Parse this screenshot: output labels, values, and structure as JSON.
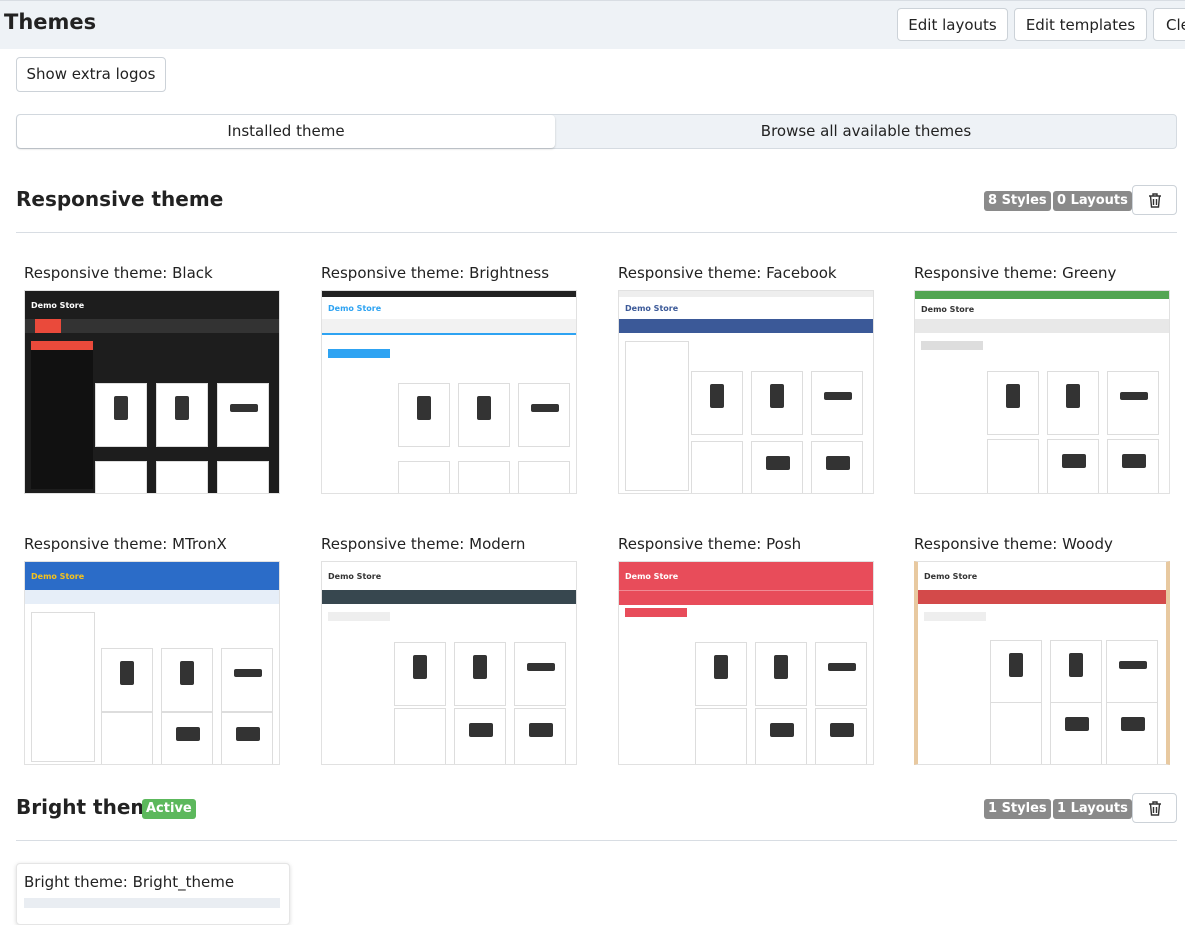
{
  "header": {
    "title": "Themes",
    "buttons": [
      "Edit layouts",
      "Edit templates",
      "Cle"
    ]
  },
  "extra_logos_button": "Show extra logos",
  "tabs": {
    "installed": "Installed theme",
    "browse": "Browse all available themes"
  },
  "responsive": {
    "title": "Responsive theme",
    "styles_badge": "8 Styles",
    "layouts_badge": "0 Layouts",
    "styles": [
      {
        "label": "Responsive theme: Black",
        "color": "#ea4a3b",
        "bg": "#1d1d1d",
        "logo": "Demo Store"
      },
      {
        "label": "Responsive theme: Brightness",
        "color": "#2ea3f2",
        "bg": "#ffffff",
        "logo": "Demo Store"
      },
      {
        "label": "Responsive theme: Facebook",
        "color": "#3b5998",
        "bg": "#ffffff",
        "logo": "Demo Store"
      },
      {
        "label": "Responsive theme: Greeny",
        "color": "#52a552",
        "bg": "#ffffff",
        "logo": "Demo Store"
      },
      {
        "label": "Responsive theme: MTronX",
        "color": "#2b6cc8",
        "bg": "#ffffff",
        "logo": "Demo Store"
      },
      {
        "label": "Responsive theme: Modern",
        "color": "#37474f",
        "bg": "#ffffff",
        "logo": "Demo Store"
      },
      {
        "label": "Responsive theme: Posh",
        "color": "#e84c5a",
        "bg": "#ffffff",
        "logo": "Demo Store"
      },
      {
        "label": "Responsive theme: Woody",
        "color": "#d34a4a",
        "bg": "#ffffff",
        "logo": "Demo Store"
      }
    ]
  },
  "bright": {
    "title": "Bright theme",
    "active_badge": "Active",
    "styles_badge": "1 Styles",
    "layouts_badge": "1 Layouts",
    "styles": [
      {
        "label": "Bright theme: Bright_theme"
      }
    ]
  },
  "icons": {
    "trash": "trash-icon"
  }
}
